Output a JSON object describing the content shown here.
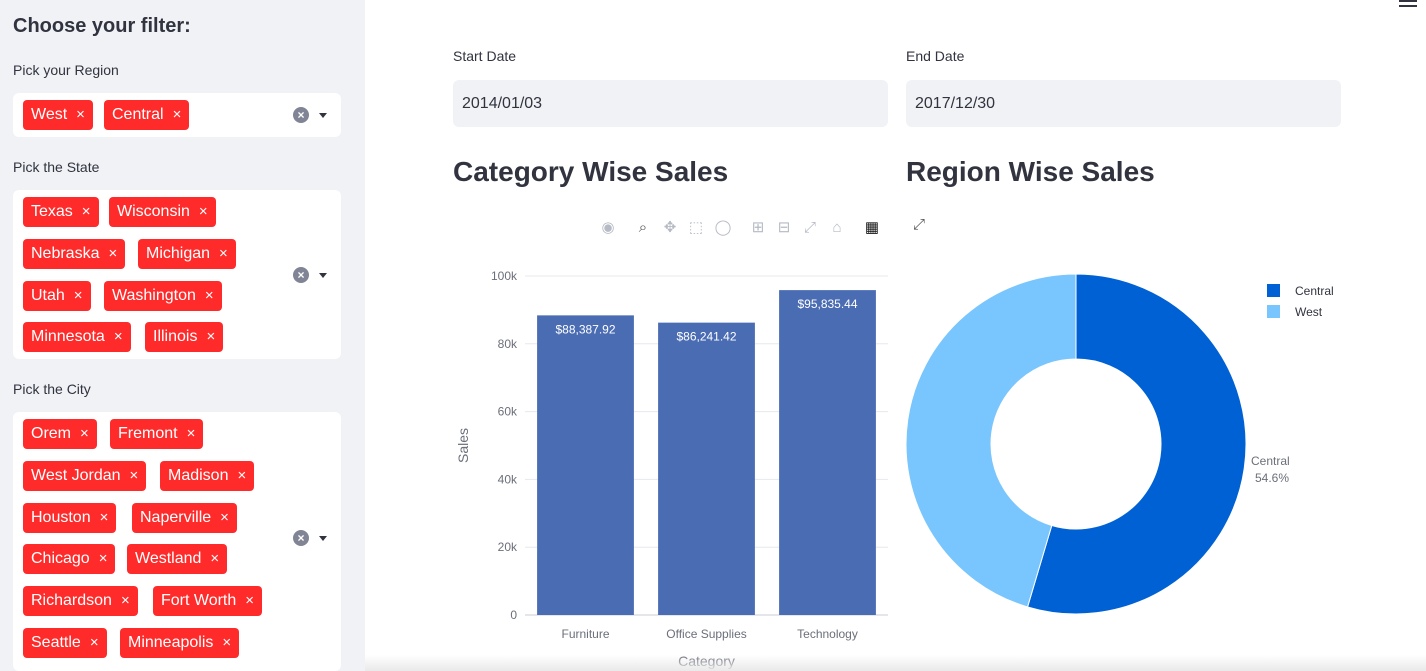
{
  "sidebar": {
    "title": "Choose your filter:",
    "region": {
      "label": "Pick your Region",
      "tags": [
        "West",
        "Central"
      ]
    },
    "state": {
      "label": "Pick the State",
      "tags": [
        "Texas",
        "Wisconsin",
        "Nebraska",
        "Michigan",
        "Utah",
        "Washington",
        "Minnesota",
        "Illinois"
      ]
    },
    "city": {
      "label": "Pick the City",
      "tags": [
        "Orem",
        "Fremont",
        "West Jordan",
        "Madison",
        "Houston",
        "Naperville",
        "Chicago",
        "Westland",
        "Richardson",
        "Fort Worth",
        "Seattle",
        "Minneapolis"
      ]
    },
    "tag_close": "×",
    "clear_icon": "clear-circle-icon",
    "dropdown_icon": "chevron-down-icon",
    "tag_color": "#ff2b2b"
  },
  "dates": {
    "start": {
      "label": "Start Date",
      "value": "2014/01/03"
    },
    "end": {
      "label": "End Date",
      "value": "2017/12/30"
    }
  },
  "category_section": {
    "title": "Category Wise Sales"
  },
  "region_section": {
    "title": "Region Wise Sales"
  },
  "modebar_icons": [
    "camera-icon",
    "zoom-icon",
    "pan-icon",
    "box-select-icon",
    "lasso-icon",
    "zoom-in-icon",
    "zoom-out-icon",
    "autoscale-icon",
    "reset-axes-icon",
    "plotly-logo-icon"
  ],
  "fullscreen_icon": "expand-icon",
  "menu_icon": "hamburger-icon",
  "chart_data": [
    {
      "type": "bar",
      "categories": [
        "Furniture",
        "Office Supplies",
        "Technology"
      ],
      "values": [
        88387.92,
        86241.42,
        95835.44
      ],
      "value_labels": [
        "$88,387.92",
        "$86,241.42",
        "$95,835.44"
      ],
      "xlabel": "Category",
      "ylabel": "Sales",
      "ylim": [
        0,
        100000
      ],
      "yticks": [
        "0",
        "20k",
        "40k",
        "60k",
        "80k",
        "100k"
      ],
      "color": "#4a6cb3",
      "grid": true
    },
    {
      "type": "pie",
      "hole": true,
      "labels": [
        "Central",
        "West"
      ],
      "values": [
        54.6,
        45.4
      ],
      "colors": [
        "#0061d4",
        "#79c5fd"
      ],
      "outside_label": "Central",
      "outside_percent": "54.6%",
      "legend": "top-right"
    }
  ]
}
